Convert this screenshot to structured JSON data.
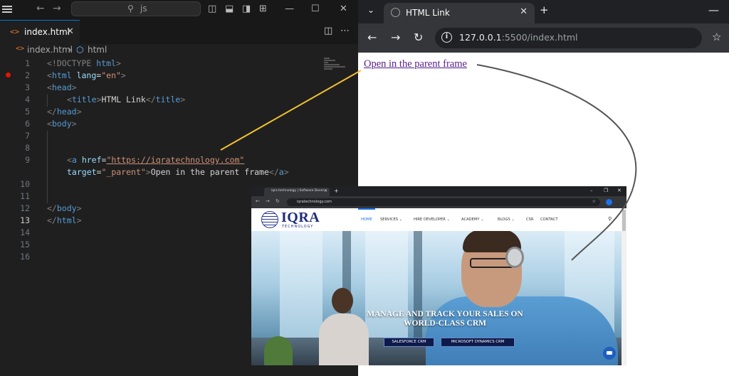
{
  "vscode": {
    "search_placeholder": "js",
    "tab_title": "index.html",
    "tab_icon": "<>",
    "breadcrumb": {
      "file": "index.html",
      "symbol": "html"
    },
    "line_numbers": [
      "1",
      "2",
      "3",
      "4",
      "5",
      "6",
      "7",
      "8",
      "9",
      "",
      "10",
      "11",
      "12",
      "13",
      "14",
      "15",
      "16"
    ],
    "active_line": "13",
    "code": {
      "l1_a": "<!DOCTYPE ",
      "l1_b": "html",
      "l1_c": ">",
      "l2_tag": "html",
      "l2_attr": "lang",
      "l2_val": "\"en\"",
      "l3_tag": "head",
      "l4_tag": "title",
      "l4_text": "HTML Link",
      "l5_tag": "head",
      "l6_tag": "body",
      "l9_tag": "a",
      "l9_attr": "href",
      "l9_val": "\"https://iqratechnology.com\"",
      "l9b_attr": "target",
      "l9b_val": "\"_parent\"",
      "l9b_text": "Open in the parent frame",
      "l9b_close": "a",
      "l12_tag": "body",
      "l13_tag": "html"
    }
  },
  "browser": {
    "tab_title": "HTML Link",
    "url_host": "127.0.0.1",
    "url_rest": ":5500/index.html",
    "link_text": "Open in the parent frame"
  },
  "inset": {
    "tab_title": "iqra technology | Software Devel...",
    "url": "iqratechnology.com",
    "logo": "IQRA",
    "logo_sub": "TECHNOLOGY",
    "menu": [
      "HOME",
      "SERVICES ⌄",
      "HIRE DEVELOPER ⌄",
      "ACADEMY ⌄",
      "BLOGS ⌄",
      "CSR",
      "CONTACT"
    ],
    "hero_title_1": "MANAGE AND TRACK YOUR SALES ON",
    "hero_title_2": "WORLD-CLASS CRM",
    "btn_salesforce": "SALESFORCE CRM",
    "btn_dynamics": "MICROSOFT DYNAMICS CRM"
  },
  "colors": {
    "vscode_bg": "#1f1f1f",
    "accent": "#0078d4",
    "breakpoint": "#e51400",
    "annotation_line": "#f2c12e",
    "annotation_curve": "#555555",
    "link_visited": "#551a8b"
  }
}
